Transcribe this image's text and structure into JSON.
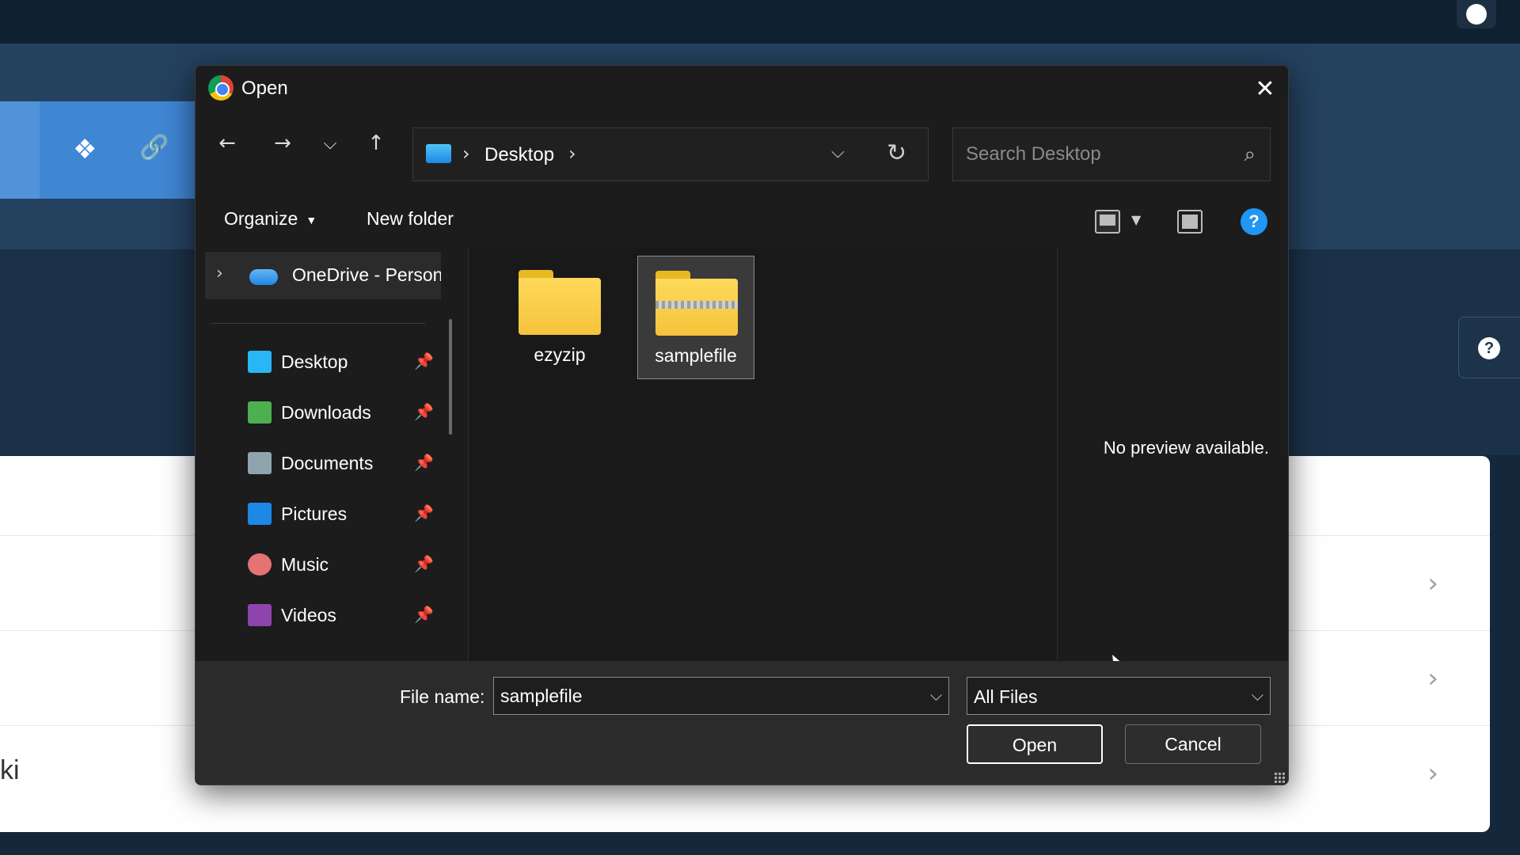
{
  "dialog": {
    "title": "Open",
    "close_glyph": "✕"
  },
  "nav": {
    "back_glyph": "←",
    "forward_glyph": "→",
    "recent_glyph": "⌵",
    "up_glyph": "↑",
    "breadcrumb": [
      "Desktop"
    ],
    "separator_glyph": "›",
    "dropdown_glyph": "⌵",
    "refresh_glyph": "↻",
    "search_placeholder": "Search Desktop",
    "search_glyph": "⌕"
  },
  "toolbar": {
    "organize_label": "Organize",
    "caret_glyph": "▼",
    "new_folder_label": "New folder",
    "help_glyph": "?"
  },
  "sidebar": {
    "expand_glyph": "›",
    "onedrive_label": "OneDrive - Personal",
    "pin_glyph": "📌",
    "items": [
      {
        "label": "Desktop",
        "icon": "desktop-icon",
        "color": "#29b6f6"
      },
      {
        "label": "Downloads",
        "icon": "download-icon",
        "color": "#4caf50"
      },
      {
        "label": "Documents",
        "icon": "document-icon",
        "color": "#90a4ae"
      },
      {
        "label": "Pictures",
        "icon": "pictures-icon",
        "color": "#1e88e5"
      },
      {
        "label": "Music",
        "icon": "music-icon",
        "color": "#e57373"
      },
      {
        "label": "Videos",
        "icon": "videos-icon",
        "color": "#8e44ad"
      }
    ]
  },
  "files": [
    {
      "name": "ezyzip",
      "type": "folder",
      "selected": false
    },
    {
      "name": "samplefile",
      "type": "zip-folder",
      "selected": true
    }
  ],
  "preview": {
    "message": "No preview available."
  },
  "footer": {
    "file_name_label": "File name:",
    "file_name_value": "samplefile",
    "file_type_value": "All Files",
    "chevron_glyph": "⌵",
    "open_label": "Open",
    "cancel_label": "Cancel"
  },
  "background": {
    "row_chevron": "›",
    "partial_text": "ki",
    "dropbox_glyph": "❖",
    "link_glyph": "🔗",
    "help_glyph": "?",
    "accent_color": "#3f86d3"
  }
}
